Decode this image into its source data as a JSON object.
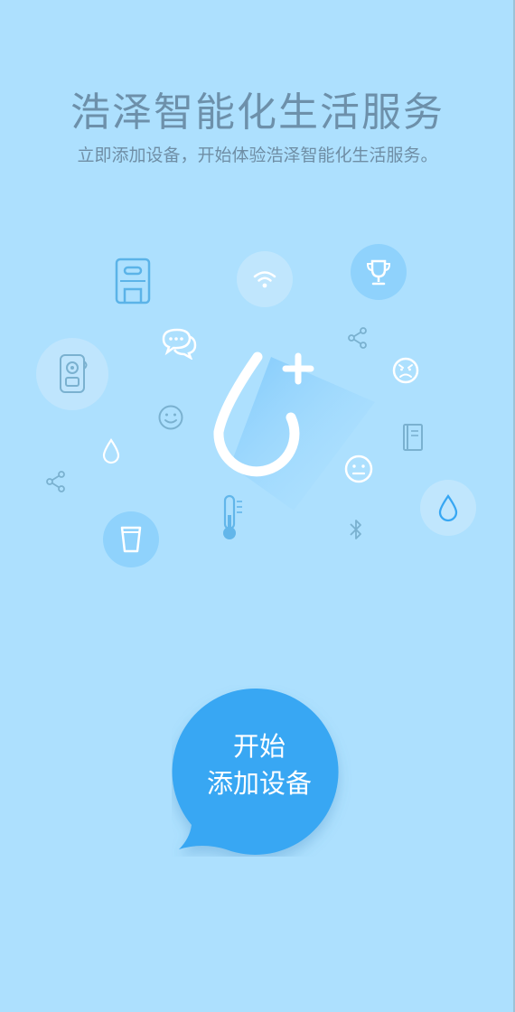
{
  "header": {
    "title": "浩泽智能化生活服务",
    "subtitle": "立即添加设备，开始体验浩泽智能化生活服务。"
  },
  "icons": [
    "water-purifier-icon",
    "wifi-icon",
    "trophy-icon",
    "chat-bubbles-icon",
    "share-icon",
    "angry-face-icon",
    "air-purifier-icon",
    "smile-face-icon",
    "book-icon",
    "water-drop-icon",
    "thermometer-icon",
    "neutral-face-icon",
    "bluetooth-icon",
    "water-cup-icon",
    "add-device-drop-icon"
  ],
  "cta": {
    "line1": "开始",
    "line2": "添加设备"
  },
  "colors": {
    "background": "#ade0fe",
    "accent": "#37a7f3",
    "title_text": "#6d90aa",
    "icon_light": "#ffffff",
    "icon_dark": "#7ab1d0"
  }
}
